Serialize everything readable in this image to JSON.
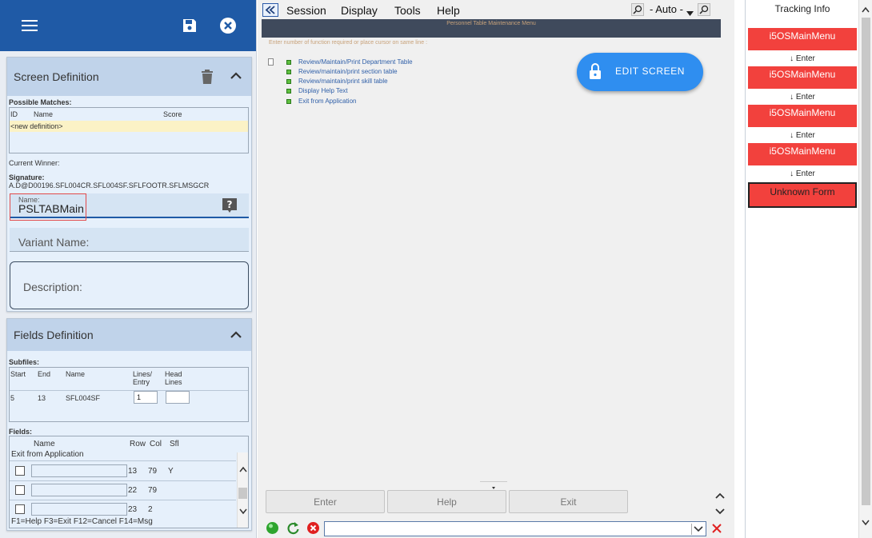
{
  "left": {
    "screen_def": {
      "title": "Screen Definition",
      "possible_matches_label": "Possible Matches:",
      "cols": [
        "ID",
        "Name",
        "Score"
      ],
      "new_def_row": "<new definition>",
      "current_winner_label": "Current Winner:",
      "signature_label": "Signature:",
      "signature_value": "A.D@D00196.SFL004CR.SFL004SF.SFLFOOTR.SFLMSGCR",
      "name_label": "Name:",
      "name_value": "PSLTABMain",
      "variant_placeholder": "Variant Name:",
      "description_placeholder": "Description:"
    },
    "fields_def": {
      "title": "Fields Definition",
      "subfiles_label": "Subfiles:",
      "subfile_cols": [
        "Start",
        "End",
        "Name",
        "Lines/ Entry",
        "Head Lines"
      ],
      "subfile_row": {
        "start": "5",
        "end": "13",
        "name": "SFL004SF",
        "lines_entry": "1",
        "head_lines": ""
      },
      "fields_label": "Fields:",
      "fields_cols": [
        "Name",
        "Row",
        "Col",
        "Sfl"
      ],
      "field_title_row": "Exit from Application",
      "field_rows": [
        {
          "name": "",
          "row": "13",
          "col": "79",
          "sfl": "Y"
        },
        {
          "name": "",
          "row": "22",
          "col": "79",
          "sfl": ""
        },
        {
          "name": "",
          "row": "23",
          "col": "2",
          "sfl": ""
        }
      ],
      "footer_text": "F1=Help F3=Exit F12=Cancel F14=Msg"
    }
  },
  "center": {
    "menu": [
      "Session",
      "Display",
      "Tools",
      "Help"
    ],
    "zoom_select": "- Auto -",
    "terminal_title": "Personnel Table Maintenance Menu",
    "instruction": "Enter number of function required or place cursor on same line :",
    "options": [
      "Review/Maintain/Print Department Table",
      "Review/maintain/print section table",
      "Review/maintain/print skill table",
      "Display Help Text",
      "Exit from Application"
    ],
    "edit_button": "EDIT SCREEN",
    "buttons": [
      "Enter",
      "Help",
      "Exit"
    ],
    "command_value": ""
  },
  "right": {
    "title": "Tracking Info",
    "entries": [
      {
        "label": "i5OSMainMenu",
        "arrow": "↓ Enter"
      },
      {
        "label": "i5OSMainMenu",
        "arrow": "↓ Enter"
      },
      {
        "label": "i5OSMainMenu",
        "arrow": "↓ Enter"
      },
      {
        "label": "i5OSMainMenu",
        "arrow": "↓ Enter"
      }
    ],
    "unknown": "Unknown Form"
  },
  "colors": {
    "header_blue": "#1f5aa6",
    "edit_blue": "#2f8ef0",
    "track_red": "#f2413d"
  }
}
